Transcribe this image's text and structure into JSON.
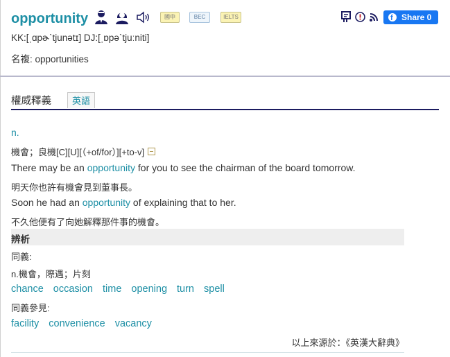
{
  "entry": {
    "word": "opportunity",
    "kk": "KK:[ˌɑpɚˋtjunətɪ]",
    "dj": "DJ:[ˌɒpəˋtjuːniti]",
    "plural": "名複: opportunities"
  },
  "badges": [
    "國中",
    "BEC",
    "IELTS"
  ],
  "share": {
    "label": "Share 0"
  },
  "icons": [
    "male-speaker-icon",
    "female-speaker-icon",
    "speaker-icon",
    "flashcard-icon",
    "report-icon",
    "rss-icon",
    "facebook-icon",
    "collapse-icon"
  ],
  "tabs": {
    "title": "權威釋義",
    "sub": "英語"
  },
  "definition": {
    "pos": "n.",
    "sense": "機會；良機[C][U][（+of/for）][+to-v]",
    "examples": [
      {
        "pre": "There may be an ",
        "hit": "opportunity",
        "post": " for you to see the chairman of the board tomorrow.",
        "zh": "明天你也許有機會見到董事長。"
      },
      {
        "pre": "Soon he had an ",
        "hit": "opportunity",
        "post": " of explaining that to her.",
        "zh": "不久他便有了向她解釋那件事的機會。"
      }
    ],
    "section": "辨析",
    "synonym_label": "同義:",
    "synonym_sense": "n.機會，際遇；片刻",
    "synonyms": [
      "chance",
      "occasion",
      "time",
      "opening",
      "turn",
      "spell"
    ],
    "see_also_label": "同義參見:",
    "see_also": [
      "facility",
      "convenience",
      "vacancy"
    ],
    "source": "以上來源於：《英漢大辭典》"
  }
}
